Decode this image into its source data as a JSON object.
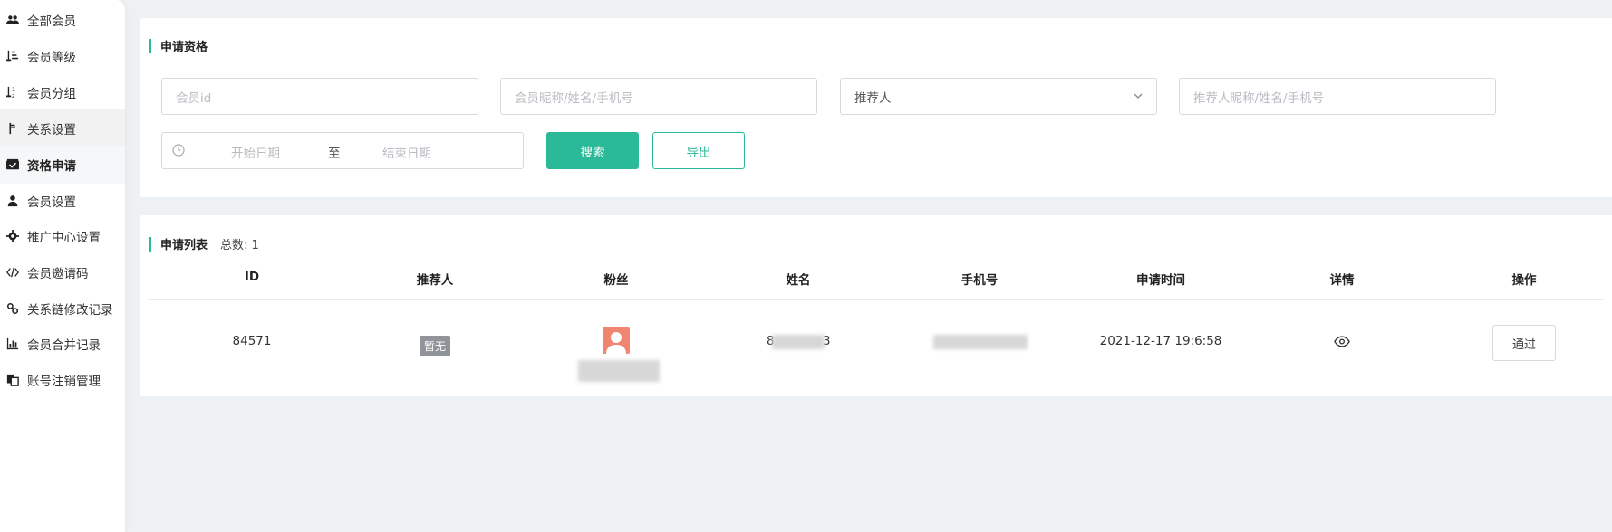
{
  "sidebar": {
    "items": [
      {
        "label": "全部会员",
        "icon": "users-icon"
      },
      {
        "label": "会员等级",
        "icon": "sort-list-icon"
      },
      {
        "label": "会员分组",
        "icon": "sort-alpha-icon"
      },
      {
        "label": "关系设置",
        "icon": "branch-icon"
      },
      {
        "label": "资格申请",
        "icon": "inbox-check-icon"
      },
      {
        "label": "会员设置",
        "icon": "user-icon"
      },
      {
        "label": "推广中心设置",
        "icon": "gear-icon"
      },
      {
        "label": "会员邀请码",
        "icon": "code-icon"
      },
      {
        "label": "关系链修改记录",
        "icon": "link-icon"
      },
      {
        "label": "会员合并记录",
        "icon": "bar-chart-icon"
      },
      {
        "label": "账号注销管理",
        "icon": "copy-icon"
      }
    ],
    "active_index": 4,
    "hover_index": 3
  },
  "filter": {
    "title": "申请资格",
    "member_id_placeholder": "会员id",
    "member_query_placeholder": "会员昵称/姓名/手机号",
    "referrer_select": "推荐人",
    "referrer_query_placeholder": "推荐人昵称/姓名/手机号",
    "start_date_placeholder": "开始日期",
    "range_separator": "至",
    "end_date_placeholder": "结束日期",
    "search_label": "搜索",
    "export_label": "导出"
  },
  "list": {
    "title": "申请列表",
    "total_label": "总数: 1",
    "columns": [
      "ID",
      "推荐人",
      "粉丝",
      "姓名",
      "手机号",
      "申请时间",
      "详情",
      "操作"
    ],
    "rows": [
      {
        "id": "84571",
        "referrer": "暂无",
        "name_prefix": "8",
        "name_suffix": "3",
        "apply_time": "2021-12-17 19:6:58",
        "action_label": "通过"
      }
    ]
  },
  "colors": {
    "accent": "#2bba97",
    "badge": "#909399",
    "avatar": "#f08670"
  }
}
